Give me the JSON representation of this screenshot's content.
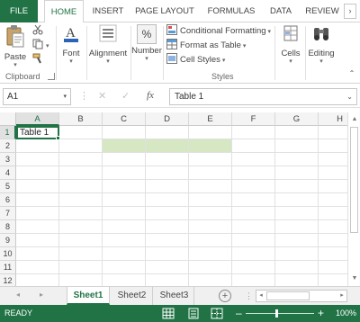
{
  "ribbon_tabs": {
    "file": "FILE",
    "home": "HOME",
    "insert": "INSERT",
    "page_layout": "PAGE LAYOUT",
    "formulas": "FORMULAS",
    "data": "DATA",
    "review": "REVIEW"
  },
  "ribbon": {
    "clipboard": {
      "paste": "Paste",
      "label": "Clipboard"
    },
    "font": {
      "label": "Font"
    },
    "alignment": {
      "label": "Alignment"
    },
    "number": {
      "label": "Number",
      "icon_glyph": "%"
    },
    "styles": {
      "conditional_formatting": "Conditional Formatting",
      "format_as_table": "Format as Table",
      "cell_styles": "Cell Styles",
      "label": "Styles"
    },
    "cells": {
      "label": "Cells"
    },
    "editing": {
      "label": "Editing"
    }
  },
  "formula_bar": {
    "name_box": "A1",
    "fx": "fx",
    "content": "Table 1"
  },
  "grid": {
    "columns": [
      "A",
      "B",
      "C",
      "D",
      "E",
      "F",
      "G",
      "H"
    ],
    "rows": [
      "1",
      "2",
      "3",
      "4",
      "5",
      "6",
      "7",
      "8",
      "9",
      "10",
      "11",
      "12"
    ],
    "selected_column": "A",
    "selected_row": "1",
    "cells": {
      "A1": "Table 1"
    },
    "highlight_fill": "#d6e7c4"
  },
  "sheets": {
    "tabs": [
      "Sheet1",
      "Sheet2",
      "Sheet3"
    ],
    "active": "Sheet1"
  },
  "status": {
    "mode": "READY",
    "zoom": "100%"
  },
  "colors": {
    "accent": "#217346",
    "highlight": "#d6e7c4"
  }
}
